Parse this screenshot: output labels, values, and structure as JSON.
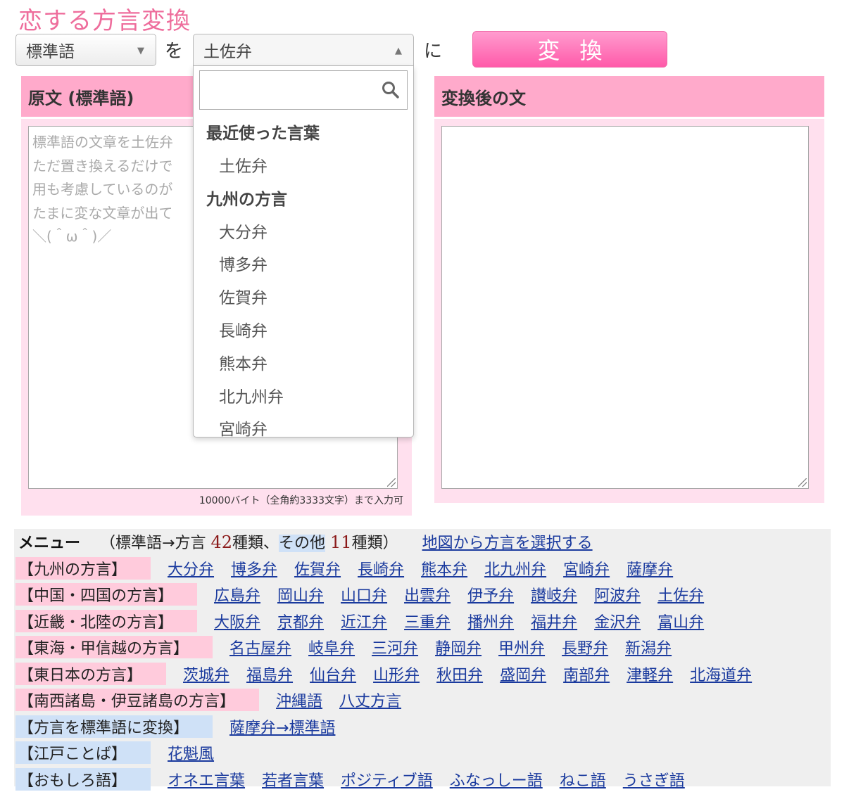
{
  "app_title": "恋する方言変換",
  "controls": {
    "source_select": "標準語",
    "target_select": "土佐弁",
    "joiner_wo": "を",
    "joiner_ni": "に",
    "convert_button": "変換"
  },
  "left_panel": {
    "title": "原文 (標準語)",
    "placeholder_lines": [
      "標準語の文章を土佐弁",
      "ただ置き換えるだけで",
      "用も考慮しているのが",
      "たまに変な文章が出て",
      "＼(＾ω＾)／"
    ],
    "limit_note": "10000バイト（全角約3333文字）まで入力可"
  },
  "right_panel": {
    "title": "変換後の文"
  },
  "dropdown": {
    "search_value": "",
    "groups": [
      {
        "label": "最近使った言葉",
        "items": [
          "土佐弁"
        ]
      },
      {
        "label": "九州の方言",
        "items": [
          "大分弁",
          "博多弁",
          "佐賀弁",
          "長崎弁",
          "熊本弁",
          "北九州弁",
          "宮崎弁"
        ]
      }
    ]
  },
  "menu": {
    "label": "メニュー",
    "count_prefix": "（標準語→方言",
    "count_a": "42",
    "count_mid1": "種類、",
    "count_mid2": "その他",
    "count_b": "11",
    "count_suffix": "種類）",
    "map_link": "地図から方言を選択する",
    "rows": [
      {
        "category": "【九州の方言】",
        "style": "pink",
        "links": [
          "大分弁",
          "博多弁",
          "佐賀弁",
          "長崎弁",
          "熊本弁",
          "北九州弁",
          "宮崎弁",
          "薩摩弁"
        ]
      },
      {
        "category": "【中国・四国の方言】",
        "style": "pink",
        "links": [
          "広島弁",
          "岡山弁",
          "山口弁",
          "出雲弁",
          "伊予弁",
          "讃岐弁",
          "阿波弁",
          "土佐弁"
        ]
      },
      {
        "category": "【近畿・北陸の方言】",
        "style": "pink",
        "links": [
          "大阪弁",
          "京都弁",
          "近江弁",
          "三重弁",
          "播州弁",
          "福井弁",
          "金沢弁",
          "富山弁"
        ]
      },
      {
        "category": "【東海・甲信越の方言】",
        "style": "pink",
        "links": [
          "名古屋弁",
          "岐阜弁",
          "三河弁",
          "静岡弁",
          "甲州弁",
          "長野弁",
          "新潟弁"
        ]
      },
      {
        "category": "【東日本の方言】",
        "style": "pink",
        "links": [
          "茨城弁",
          "福島弁",
          "仙台弁",
          "山形弁",
          "秋田弁",
          "盛岡弁",
          "南部弁",
          "津軽弁",
          "北海道弁"
        ]
      },
      {
        "category": "【南西諸島・伊豆諸島の方言】",
        "style": "pink",
        "links": [
          "沖縄語",
          "八丈方言"
        ]
      },
      {
        "category": "【方言を標準語に変換】",
        "style": "blue",
        "links": [
          "薩摩弁→標準語"
        ]
      },
      {
        "category": "【江戸ことば】",
        "style": "blue",
        "links": [
          "花魁風"
        ]
      },
      {
        "category": "【おもしろ語】",
        "style": "blue",
        "links": [
          "オネエ言葉",
          "若者言葉",
          "ポジティブ語",
          "ふなっしー語",
          "ねこ語",
          "うさぎ語"
        ]
      }
    ]
  }
}
